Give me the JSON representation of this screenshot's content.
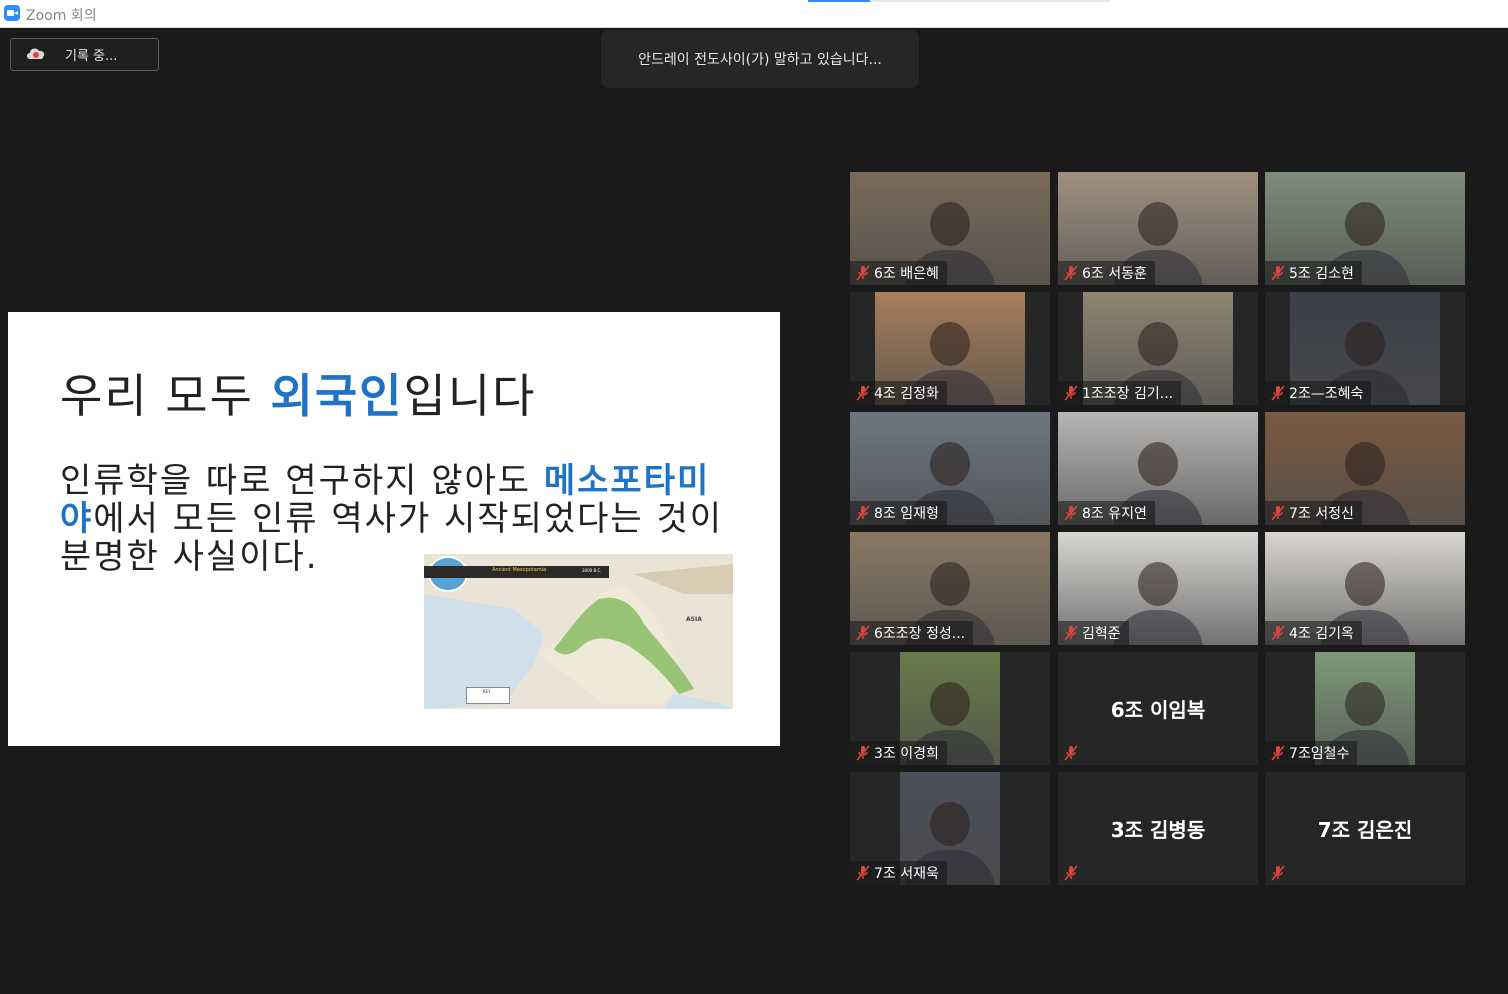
{
  "window": {
    "title": "Zoom 회의"
  },
  "recording": {
    "label": "기록 중..."
  },
  "active_speaker": {
    "text": "안드레이 전도사이(가) 말하고 있습니다..."
  },
  "slide": {
    "heading_pre": "우리 모두 ",
    "heading_highlight": "외국인",
    "heading_post": "입니다",
    "body_pre": "인류학을 따로 연구하지 않아도 ",
    "body_highlight": "메소포타미야",
    "body_post": "에서 모든 인류 역사가 시작되었다는 것이 분명한 사실이다.",
    "map": {
      "title": "Ancient Mesopotamia",
      "date": "3000 B.C.",
      "region_label": "ASIA",
      "key_label": "KEY"
    }
  },
  "participants": [
    {
      "name": "6조 배은혜",
      "video": true,
      "bg": "#7a6a58"
    },
    {
      "name": "6조 서동훈",
      "video": true,
      "bg": "#a09080"
    },
    {
      "name": "5조 김소현",
      "video": true,
      "bg": "#7f8c7a"
    },
    {
      "name": "4조 김정화",
      "video": true,
      "bg": "#a77e5a"
    },
    {
      "name": "1조조장 김기...",
      "video": true,
      "bg": "#8e8672"
    },
    {
      "name": "2조—조혜숙",
      "video": true,
      "bg": "#3c4048"
    },
    {
      "name": "8조 임재형",
      "video": true,
      "bg": "#6d7680"
    },
    {
      "name": "8조 유지연",
      "video": true,
      "bg": "#b7b6b4"
    },
    {
      "name": "7조 서정신",
      "video": true,
      "bg": "#7a5a42"
    },
    {
      "name": "6조조장 정성...",
      "video": true,
      "bg": "#8a7864"
    },
    {
      "name": "김혁준",
      "video": true,
      "bg": "#d7d6d3"
    },
    {
      "name": "4조 김기옥",
      "video": true,
      "bg": "#dad7d2"
    },
    {
      "name": "3조 이경희",
      "video": true,
      "bg": "#6a7a4a"
    },
    {
      "name": "6조 이임복",
      "video": false
    },
    {
      "name": "7조임철수",
      "video": true,
      "bg": "#7d9a78"
    },
    {
      "name": "7조 서재욱",
      "video": true,
      "bg": "#4a4e58"
    },
    {
      "name": "3조 김병동",
      "video": false
    },
    {
      "name": "7조 김은진",
      "video": false
    }
  ]
}
